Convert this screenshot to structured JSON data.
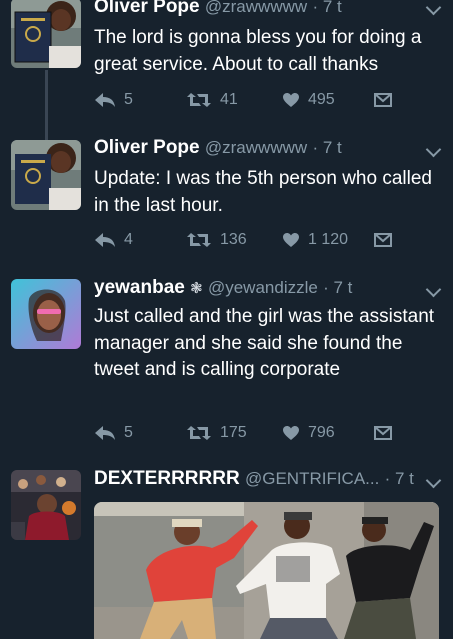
{
  "tweets": [
    {
      "display_name": "Oliver Pope",
      "handle": "@zrawwwww",
      "time": "· 7 t",
      "text": "The lord is gonna bless you for doing a great service. About to call thanks",
      "replies": "5",
      "retweets": "41",
      "likes": "495"
    },
    {
      "display_name": "Oliver Pope",
      "handle": "@zrawwwww",
      "time": "· 7 t",
      "text": "Update: I was the 5th person who called in the last hour.",
      "replies": "4",
      "retweets": "136",
      "likes": "1 120"
    },
    {
      "display_name": "yewanbae",
      "badge": "❃",
      "handle": "@yewandizzle",
      "time": "· 7 t",
      "text": "Just called and the girl was the assistant manager and she said she found the tweet and is calling corporate",
      "replies": "5",
      "retweets": "175",
      "likes": "796"
    },
    {
      "display_name": "DEXTERRRRRR",
      "handle": "@GENTRIFICA...",
      "time": "· 7 t"
    }
  ],
  "icons": {
    "reply": "reply-icon",
    "retweet": "retweet-icon",
    "like": "heart-icon",
    "message": "direct-message-icon",
    "more": "chevron-down-icon"
  },
  "colors": {
    "background": "#17222d",
    "secondary_text": "#8799a6",
    "thread_line": "#3a4654"
  }
}
